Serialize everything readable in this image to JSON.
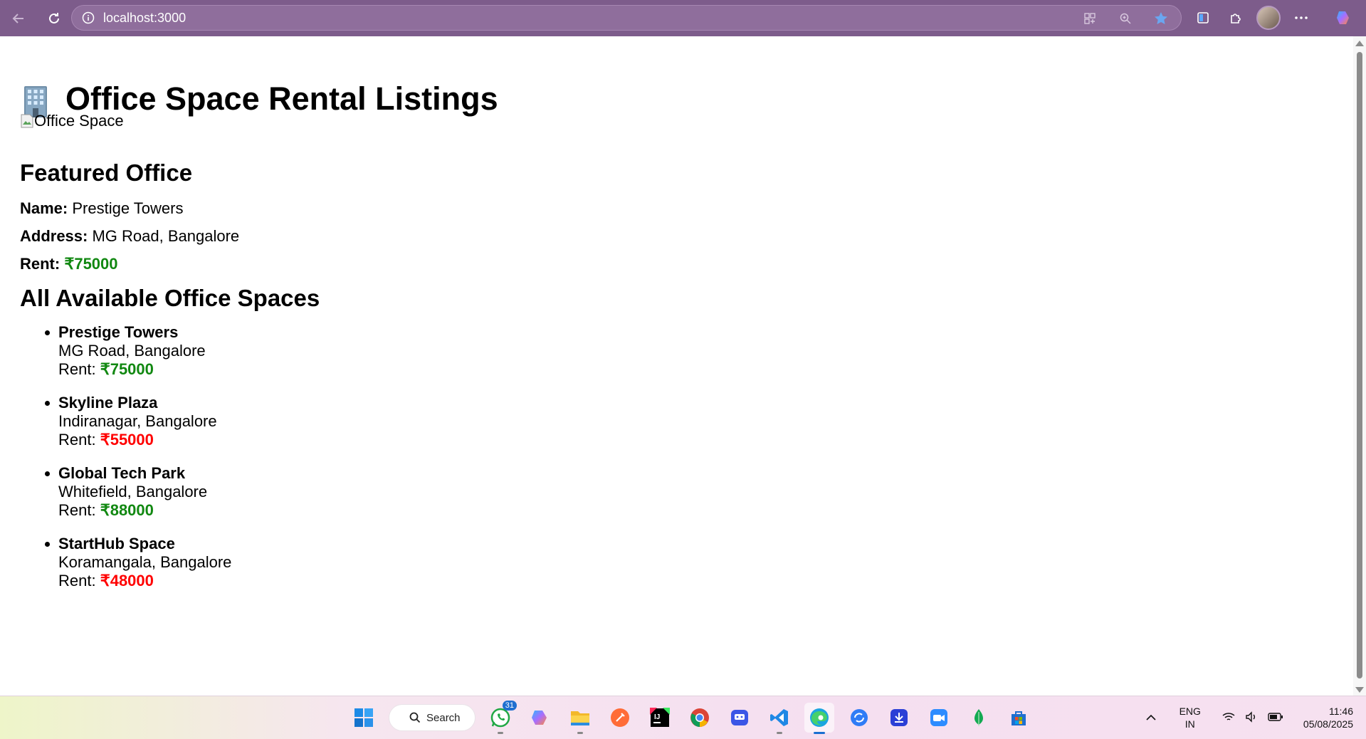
{
  "browser": {
    "url": "localhost:3000"
  },
  "page": {
    "heading": "Office Space Rental Listings",
    "heading_icon": "office-building-icon",
    "image_alt": "Office Space",
    "featured": {
      "title": "Featured Office",
      "name_label": "Name:",
      "name": "Prestige Towers",
      "address_label": "Address:",
      "address": "MG Road, Bangalore",
      "rent_label": "Rent:",
      "rent": "₹75000",
      "rent_color": "#118811"
    },
    "all_title": "All Available Office Spaces",
    "rent_prefix": "Rent:",
    "listings": [
      {
        "name": "Prestige Towers",
        "address": "MG Road, Bangalore",
        "rent": "₹75000",
        "rent_color": "#118811"
      },
      {
        "name": "Skyline Plaza",
        "address": "Indiranagar, Bangalore",
        "rent": "₹55000",
        "rent_color": "#ff0000"
      },
      {
        "name": "Global Tech Park",
        "address": "Whitefield, Bangalore",
        "rent": "₹88000",
        "rent_color": "#118811"
      },
      {
        "name": "StartHub Space",
        "address": "Koramangala, Bangalore",
        "rent": "₹48000",
        "rent_color": "#ff0000"
      }
    ]
  },
  "taskbar": {
    "search_label": "Search",
    "whatsapp_badge": "31",
    "lang_top": "ENG",
    "lang_bottom": "IN",
    "time": "11:46",
    "date": "05/08/2025"
  }
}
